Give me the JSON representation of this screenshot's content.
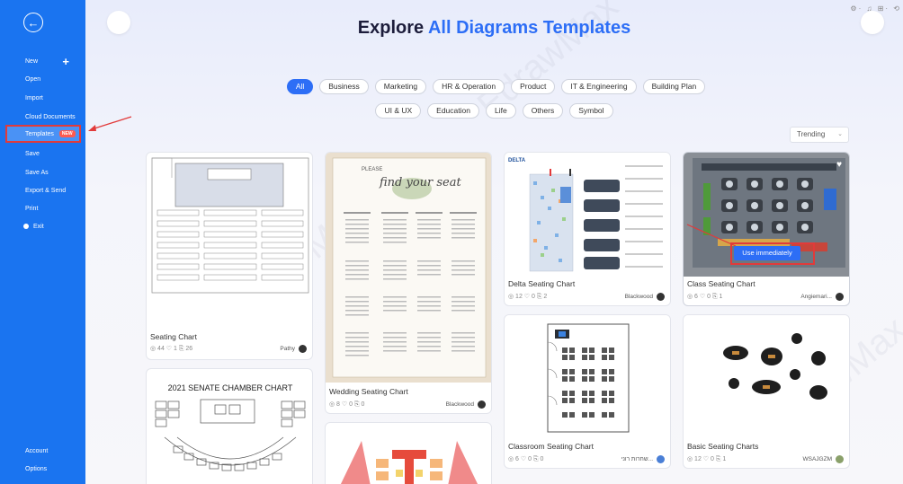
{
  "sidebar": {
    "items": [
      {
        "label": "New"
      },
      {
        "label": "Open"
      },
      {
        "label": "Import"
      },
      {
        "label": "Cloud Documents"
      },
      {
        "label": "Templates",
        "badge": "NEW"
      },
      {
        "label": "Save"
      },
      {
        "label": "Save As"
      },
      {
        "label": "Export & Send"
      },
      {
        "label": "Print"
      },
      {
        "label": "Exit"
      }
    ],
    "bottom": [
      {
        "label": "Account"
      },
      {
        "label": "Options"
      }
    ]
  },
  "header": {
    "title_plain": "Explore ",
    "title_accent": "All Diagrams Templates"
  },
  "filters": {
    "row1": [
      "All",
      "Business",
      "Marketing",
      "HR & Operation",
      "Product",
      "IT & Engineering",
      "Building Plan"
    ],
    "row2": [
      "UI & UX",
      "Education",
      "Life",
      "Others",
      "Symbol"
    ],
    "active": "All"
  },
  "sort": {
    "value": "Trending"
  },
  "cards": [
    {
      "title": "Seating Chart",
      "stats": "◎ 44  ♡ 1  ⎘ 26",
      "author": "Pathy"
    },
    {
      "title": "2021 SENATE CHAMBER CHART"
    },
    {
      "title": "Wedding Seating Chart",
      "stats": "◎ 8  ♡ 0  ⎘ 0",
      "author": "Blackwood"
    },
    {
      "title": "Delta Seating Chart",
      "stats": "◎ 12  ♡ 0  ⎘ 2",
      "author": "Blackwood"
    },
    {
      "title": "Class Seating Chart",
      "stats": "◎ 6  ♡ 0  ⎘ 1",
      "author": "Angiemari...",
      "action": "Use immediately"
    },
    {
      "title": "Classroom Seating Chart",
      "stats": "◎ 6  ♡ 0  ⎘ 0",
      "author": "שחרות רוני..."
    },
    {
      "title": "Basic Seating Charts",
      "stats": "◎ 12  ♡ 0  ⎘ 1",
      "author": "WSAJGZM"
    }
  ],
  "thumb_text": {
    "wedding_please": "PLEASE",
    "wedding_script": "find your seat",
    "delta_label": "DELTA"
  },
  "watermark": "EdrawMax",
  "colors": {
    "sidebar": "#1a74f0",
    "accent": "#2d6ef6",
    "annotation": "#e23a3a"
  }
}
